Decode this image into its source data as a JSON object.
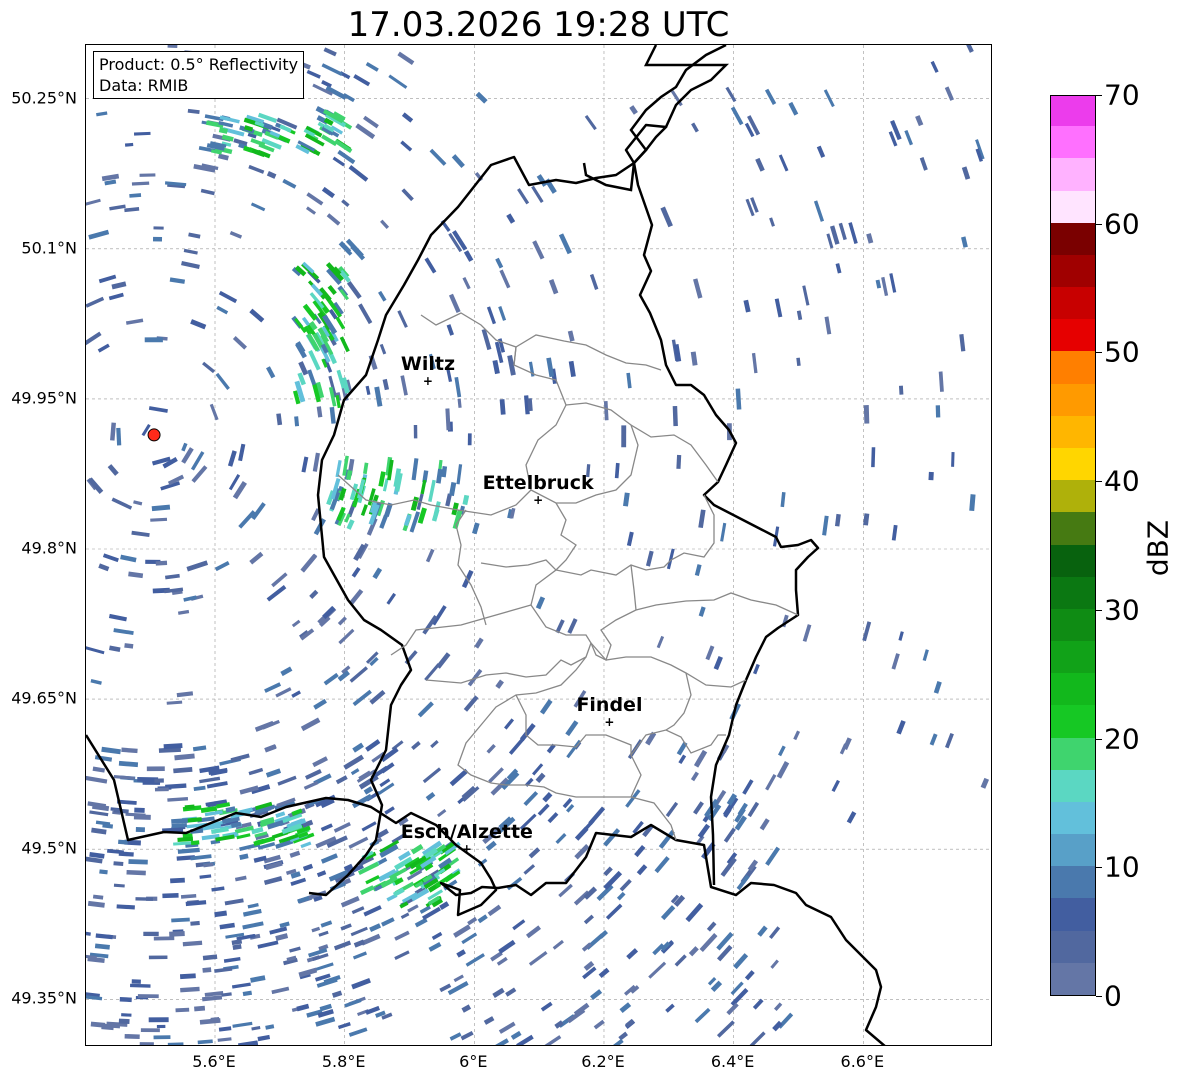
{
  "title": "17.03.2026 19:28 UTC",
  "info_box": {
    "product": "Product: 0.5° Reflectivity",
    "data": "Data: RMIB"
  },
  "lat_ticks": [
    {
      "label": "50.25°N",
      "value": 50.25
    },
    {
      "label": "50.1°N",
      "value": 50.1
    },
    {
      "label": "49.95°N",
      "value": 49.95
    },
    {
      "label": "49.8°N",
      "value": 49.8
    },
    {
      "label": "49.65°N",
      "value": 49.65
    },
    {
      "label": "49.5°N",
      "value": 49.5
    },
    {
      "label": "49.35°N",
      "value": 49.35
    }
  ],
  "lon_ticks": [
    {
      "label": "5.6°E",
      "value": 5.6
    },
    {
      "label": "5.8°E",
      "value": 5.8
    },
    {
      "label": "6°E",
      "value": 6.0
    },
    {
      "label": "6.2°E",
      "value": 6.2
    },
    {
      "label": "6.4°E",
      "value": 6.4
    },
    {
      "label": "6.6°E",
      "value": 6.6
    }
  ],
  "extent": {
    "lon_min": 5.4,
    "lon_max": 6.8,
    "lat_min": 49.3,
    "lat_max": 50.3
  },
  "cities": [
    {
      "name": "Wiltz",
      "lon": 5.93,
      "lat": 49.967
    },
    {
      "name": "Ettelbruck",
      "lon": 6.1,
      "lat": 49.848
    },
    {
      "name": "Findel",
      "lon": 6.21,
      "lat": 49.626
    },
    {
      "name": "Esch/Alzette",
      "lon": 5.99,
      "lat": 49.499
    }
  ],
  "radar_site": {
    "lon": 5.506,
    "lat": 49.914,
    "color": "#ff2a1a"
  },
  "colorbar": {
    "label": "dBZ",
    "min": 0,
    "max": 70,
    "ticks": [
      0,
      10,
      20,
      30,
      40,
      50,
      60,
      70
    ],
    "tick_labels": [
      "0",
      "10",
      "20",
      "30",
      "40",
      "50",
      "60",
      "70"
    ],
    "colors": [
      "#6476a6",
      "#51689f",
      "#425ea0",
      "#4a79ad",
      "#58a0c8",
      "#62c0db",
      "#5bd7c2",
      "#3fd46e",
      "#16c824",
      "#12b81c",
      "#11a218",
      "#0f8c14",
      "#0b7812",
      "#08620e",
      "#467a12",
      "#afb10a",
      "#ffd600",
      "#ffb600",
      "#ff9a00",
      "#ff7f00",
      "#e60000",
      "#c80000",
      "#a00000",
      "#7a0000",
      "#ffe4ff",
      "#ffb2ff",
      "#ff70ff",
      "#ec3cec"
    ]
  }
}
